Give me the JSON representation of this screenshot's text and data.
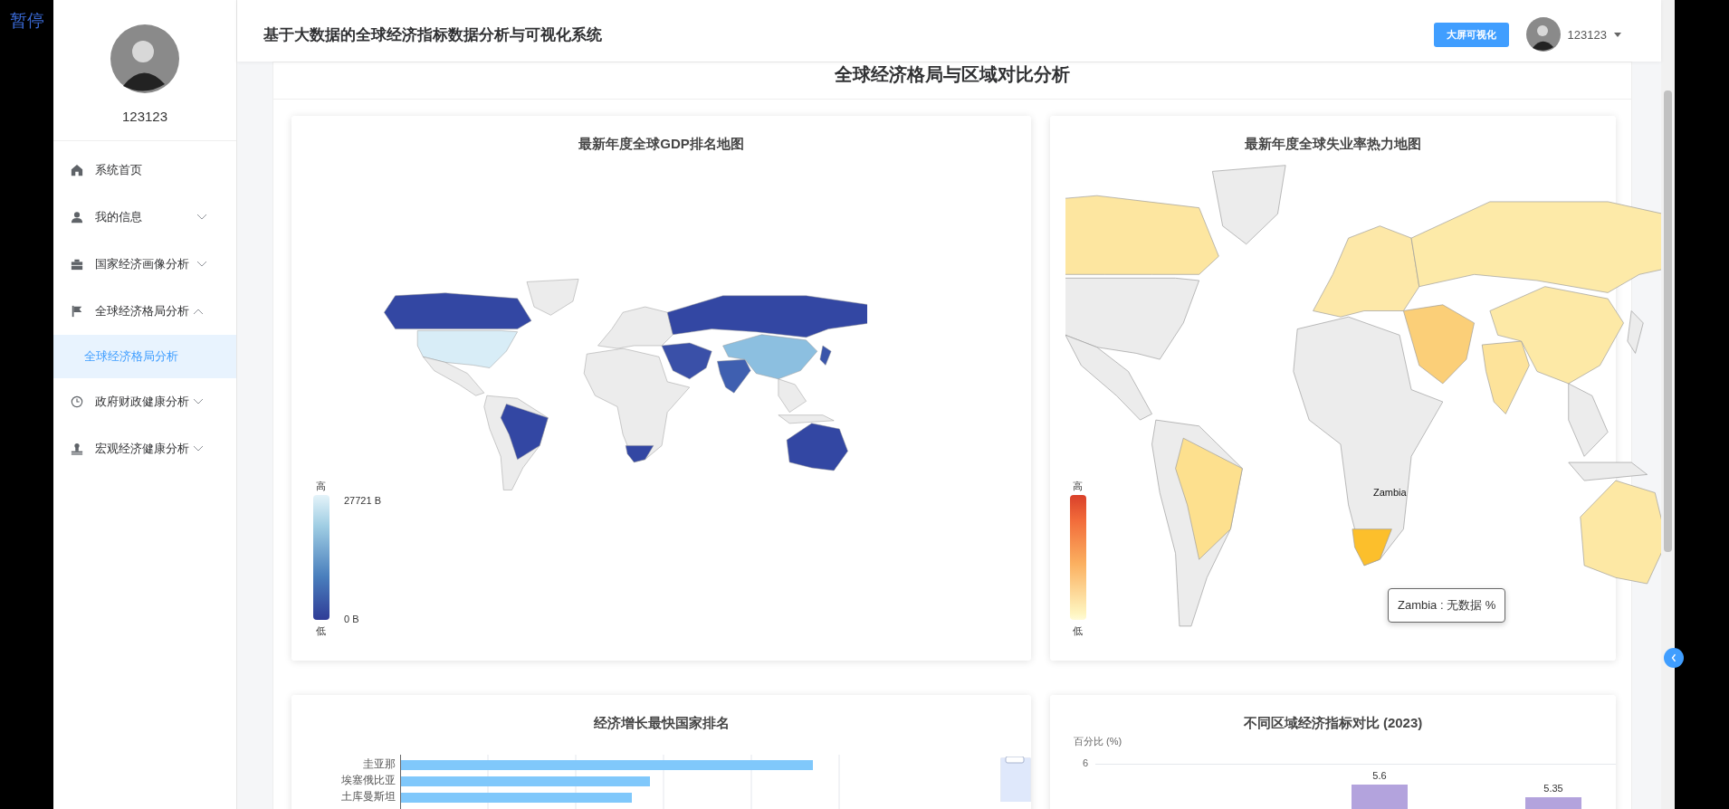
{
  "overlay_label": "暂停",
  "user": {
    "name": "123123"
  },
  "sidebar": {
    "items": [
      {
        "label": "系统首页"
      },
      {
        "label": "我的信息",
        "expanded": false
      },
      {
        "label": "国家经济画像分析",
        "expanded": false
      },
      {
        "label": "全球经济格局分析",
        "expanded": true,
        "children": [
          {
            "label": "全球经济格局分析",
            "selected": true
          }
        ]
      },
      {
        "label": "政府财政健康分析",
        "expanded": false
      },
      {
        "label": "宏观经济健康分析",
        "expanded": false
      }
    ]
  },
  "header": {
    "title": "基于大数据的全球经济指标数据分析与可视化系统",
    "screen_button": "大屏可视化",
    "user_name": "123123"
  },
  "page_title": "全球经济格局与区域对比分析",
  "gdp_map": {
    "title": "最新年度全球GDP排名地图",
    "legend": {
      "high": "高",
      "low": "低",
      "max": "27721 B",
      "min": "0 B"
    }
  },
  "unemployment_map": {
    "title": "最新年度全球失业率热力地图",
    "legend": {
      "high": "高",
      "low": "低"
    },
    "map_label": "Zambia",
    "tooltip": "Zambia : 无数据 %"
  },
  "growth_ranking": {
    "title": "经济增长最快国家排名",
    "countries": [
      "圭亚那",
      "埃塞俄比亚",
      "土库曼斯坦"
    ],
    "zoom_range": {
      "level": 1
    }
  },
  "region_comparison": {
    "title": "不同区域经济指标对比 (2023)",
    "y_axis_name": "百分比 (%)",
    "y_tick": "6",
    "bar_labels": [
      "5.6",
      "5.35"
    ]
  }
}
